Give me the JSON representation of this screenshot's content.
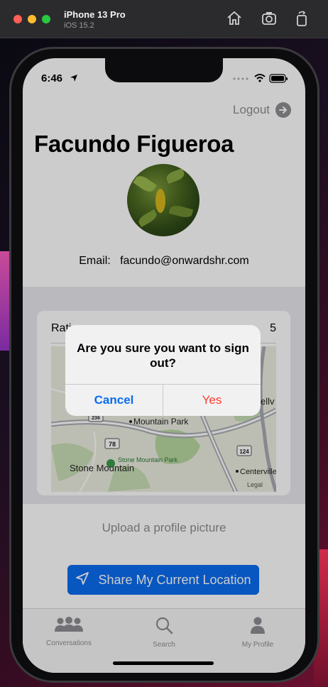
{
  "simulator": {
    "device": "iPhone 13 Pro",
    "os": "iOS 15.2"
  },
  "status_bar": {
    "time": "6:46"
  },
  "header": {
    "logout_label": "Logout"
  },
  "profile": {
    "name": "Facundo Figueroa",
    "email_label": "Email:",
    "email": "facundo@onwardshr.com"
  },
  "rating_card": {
    "label": "Rati",
    "value": "5",
    "map": {
      "places": [
        "Mountain Park",
        "Stone Mountain Park",
        "Stone Mountain",
        "Centerville",
        "ellv"
      ],
      "route_badges": [
        "236",
        "78",
        "124"
      ],
      "legal": "Legal"
    }
  },
  "upload_label": "Upload a profile picture",
  "share_button_label": "Share My Current Location",
  "tabs": [
    {
      "label": "Conversations",
      "icon": "people-icon"
    },
    {
      "label": "Search",
      "icon": "search-icon"
    },
    {
      "label": "My Profile",
      "icon": "person-icon"
    }
  ],
  "alert": {
    "title": "Are you sure you want to sign out?",
    "cancel_label": "Cancel",
    "confirm_label": "Yes"
  },
  "colors": {
    "accent": "#0a6cf0",
    "destructive": "#ff3b30",
    "secondary_text": "#8e8e93"
  }
}
